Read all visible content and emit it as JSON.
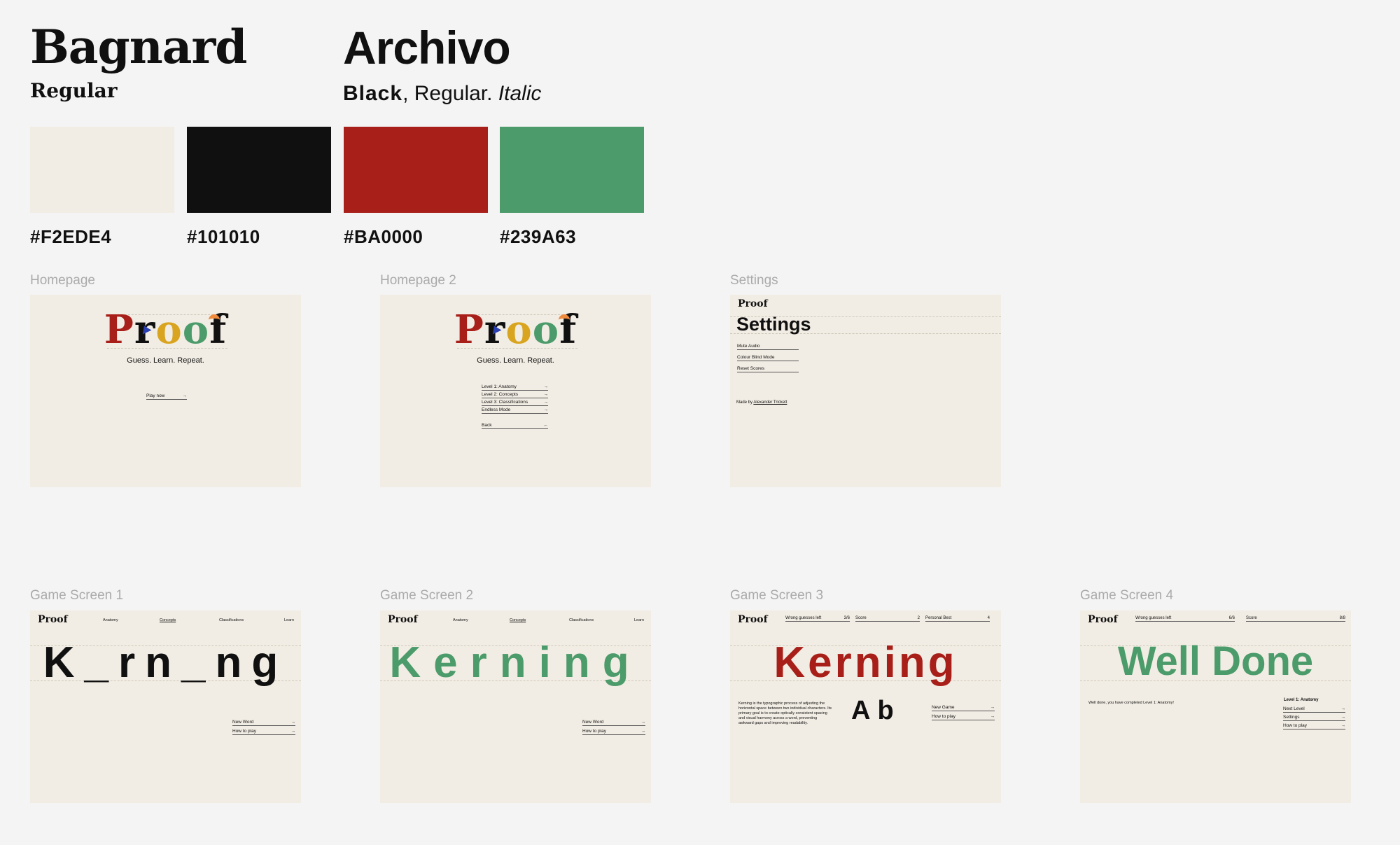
{
  "fonts": {
    "serif_name": "Bagnard",
    "serif_weight": "Regular",
    "sans_name": "Archivo",
    "sans_weight_black": "Black",
    "sans_weight_rest": ", Regular. ",
    "sans_weight_italic": "Italic"
  },
  "palette": [
    {
      "hex": "#F2EDE4",
      "color": "#f2ede4"
    },
    {
      "hex": "#101010",
      "color": "#101010"
    },
    {
      "hex": "#BA0000",
      "color": "#a81f19"
    },
    {
      "hex": "#239A63",
      "color": "#4c9b6a"
    }
  ],
  "frames": {
    "homepage": {
      "label": "Homepage",
      "logo": [
        "P",
        "r",
        "o",
        "o",
        "f"
      ],
      "tagline": "Guess. Learn. Repeat.",
      "play": "Play now",
      "arrow": "→"
    },
    "homepage2": {
      "label": "Homepage 2",
      "logo": [
        "P",
        "r",
        "o",
        "o",
        "f"
      ],
      "tagline": "Guess. Learn. Repeat.",
      "levels": [
        "Level 1: Anatomy",
        "Level 2: Concepts",
        "Level 3: Classifications",
        "Endless Mode"
      ],
      "back": "Back",
      "arrow": "→",
      "back_arrow": "←"
    },
    "settings": {
      "label": "Settings",
      "logo": "Proof",
      "title": "Settings",
      "options": [
        "Mute Audio",
        "Colour Blind Mode",
        "Reset Scores"
      ],
      "credit_prefix": "Made by ",
      "credit_name": "Alexander Trickett"
    },
    "game1": {
      "label": "Game Screen 1",
      "logo": "Proof",
      "nav": [
        "Anatomy",
        "Concepts",
        "Classifications",
        "Learn"
      ],
      "word": "K_rn_ng",
      "actions": [
        "New Word",
        "How to play"
      ],
      "arrow": "→"
    },
    "game2": {
      "label": "Game Screen 2",
      "logo": "Proof",
      "nav": [
        "Anatomy",
        "Concepts",
        "Classifications",
        "Learn"
      ],
      "word": "Kerning",
      "actions": [
        "New Word",
        "How to play"
      ],
      "arrow": "→"
    },
    "game3": {
      "label": "Game Screen 3",
      "logo": "Proof",
      "stats": [
        {
          "label": "Wrong guesses left",
          "value": "3/6"
        },
        {
          "label": "Score",
          "value": "2"
        },
        {
          "label": "Personal Best",
          "value": "4"
        }
      ],
      "word": "Kerning",
      "definition": "Kerning is the typographic process of adjusting the horizontal space between two individual characters. Its primary goal is to create optically consistent spacing and visual harmony across a word, preventing awkward gaps and improving readability.",
      "sample": "Ab",
      "actions": [
        "New Game",
        "How to play"
      ],
      "arrow": "→"
    },
    "game4": {
      "label": "Game Screen 4",
      "logo": "Proof",
      "stats": [
        {
          "label": "Wrong guesses left",
          "value": "6/6"
        },
        {
          "label": "Score",
          "value": "8/8"
        }
      ],
      "word": "Well Done",
      "message": "Well done, you have completed Level 1: Anatomy!",
      "level_title": "Level 1: Anatomy",
      "actions": [
        "Next Level",
        "Settings",
        "How to play"
      ],
      "arrow": "→"
    }
  }
}
